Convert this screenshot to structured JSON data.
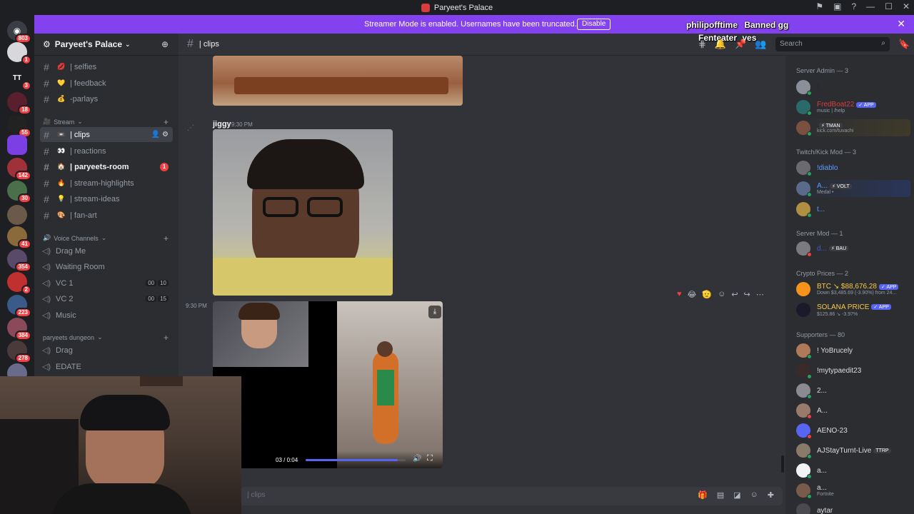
{
  "window": {
    "title": "Paryeet's Palace"
  },
  "banner": {
    "message": "Streamer Mode is enabled. Usernames have been truncated.",
    "disable_label": "Disable",
    "overlay_1": "philipofftime",
    "overlay_1b": "Banned gg",
    "overlay_2": "Fenteater",
    "overlay_2b": "yes"
  },
  "rail": {
    "badges": [
      "803",
      "1",
      "3",
      "18",
      "55",
      "142",
      "30",
      "41",
      "354",
      "2",
      "223",
      "384",
      "278"
    ],
    "tt_label": "TT"
  },
  "server": {
    "name": "Paryeet's Palace"
  },
  "channels": [
    {
      "emoji": "💋",
      "label": "| selfies"
    },
    {
      "emoji": "💛",
      "label": "| feedback"
    },
    {
      "emoji": "💰",
      "label": "-parlays"
    }
  ],
  "stream_category": "Stream",
  "stream_channels": [
    {
      "emoji": "📼",
      "label": "| clips"
    },
    {
      "emoji": "👀",
      "label": "| reactions"
    },
    {
      "emoji": "🏠",
      "label": "| paryeets-room",
      "mention": "1"
    },
    {
      "emoji": "🔥",
      "label": "| stream-highlights"
    },
    {
      "emoji": "💡",
      "label": "| stream-ideas"
    },
    {
      "emoji": "🎨",
      "label": "| fan-art"
    }
  ],
  "voice_category": "Voice Channels",
  "voice_channels": [
    {
      "label": "Drag Me"
    },
    {
      "label": "Waiting Room"
    },
    {
      "label": "VC 1",
      "c1": "00",
      "c2": "10"
    },
    {
      "label": "VC 2",
      "c1": "00",
      "c2": "15"
    },
    {
      "label": "Music"
    }
  ],
  "dungeon_category": "paryeets dungeon",
  "dungeon_channels": [
    {
      "label": "Drag"
    },
    {
      "label": "EDATE"
    }
  ],
  "header": {
    "channel": "| clips",
    "search_placeholder": "Search"
  },
  "messages": {
    "author": "jiggy",
    "time1": "9:30 PM",
    "time2": "9:30 PM",
    "video_time": "03 / 0:04"
  },
  "members": {
    "groups": {
      "admin": "Server Admin — 3",
      "mod": "Twitch/Kick Mod — 3",
      "smod": "Server Mod — 1",
      "crypto": "Crypto Prices — 2",
      "supporters": "Supporters — 80"
    },
    "admin": [
      {
        "name": "f..."
      },
      {
        "name": "FredBoat22",
        "tag": "✓ APP",
        "sub": "music | /help"
      },
      {
        "name": "",
        "tag": "⚡ TMAN",
        "sub": "kick.com/tuvachi"
      }
    ],
    "mods": [
      {
        "name": "!diablo"
      },
      {
        "name": "A...",
        "tag": "⚡ VOLT",
        "sub": "Medal •"
      },
      {
        "name": "t..."
      }
    ],
    "smod": [
      {
        "name": "d...",
        "tag": "⚡ BAU"
      }
    ],
    "crypto": [
      {
        "name": "BTC ↘ $88,676.28",
        "tag": "✓ APP",
        "sub": "Down $3,485.69 (-3.90%) from 24..."
      },
      {
        "name": "SOLANA PRICE",
        "tag": "✓ APP",
        "sub": "$125.86 ↘ -3.97%"
      }
    ],
    "supporters": [
      {
        "name": "! YoBrucely"
      },
      {
        "name": "!mytypaedit23"
      },
      {
        "name": "2..."
      },
      {
        "name": "A..."
      },
      {
        "name": "AENO-23"
      },
      {
        "name": "AJStayTurnt-Live",
        "tag": "TTRP"
      },
      {
        "name": "a..."
      },
      {
        "name": "a...",
        "sub": "Fortnite"
      },
      {
        "name": "aytar"
      }
    ]
  },
  "composer": {
    "placeholder": "| clips"
  },
  "colors": {
    "accent": "#5865f2",
    "banner": "#8441f0",
    "mention": "#f23f43",
    "online": "#23a55a"
  }
}
